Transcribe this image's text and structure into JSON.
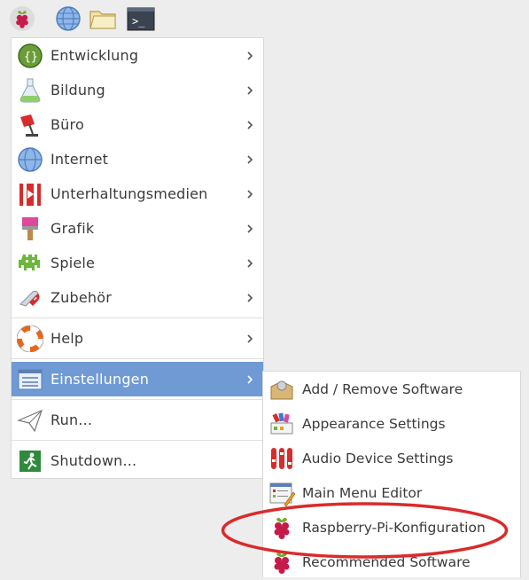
{
  "taskbar": {
    "icons": [
      "raspberry-icon",
      "globe-icon",
      "folder-icon",
      "terminal-icon"
    ],
    "terminal_glyph": ">_"
  },
  "menu": {
    "items": [
      {
        "label": "Entwicklung",
        "icon": "development-icon",
        "submenu": true
      },
      {
        "label": "Bildung",
        "icon": "education-flask-icon",
        "submenu": true
      },
      {
        "label": "Büro",
        "icon": "office-lamp-icon",
        "submenu": true
      },
      {
        "label": "Internet",
        "icon": "globe-icon",
        "submenu": true
      },
      {
        "label": "Unterhaltungsmedien",
        "icon": "media-icon",
        "submenu": true
      },
      {
        "label": "Grafik",
        "icon": "paintbrush-icon",
        "submenu": true
      },
      {
        "label": "Spiele",
        "icon": "game-invader-icon",
        "submenu": true
      },
      {
        "label": "Zubehör",
        "icon": "accessories-knife-icon",
        "submenu": true
      }
    ],
    "help": {
      "label": "Help",
      "icon": "lifebuoy-icon",
      "submenu": true
    },
    "settings": {
      "label": "Einstellungen",
      "icon": "settings-icon",
      "submenu": true,
      "selected": true
    },
    "run": {
      "label": "Run...",
      "icon": "paper-plane-icon"
    },
    "shutdown": {
      "label": "Shutdown...",
      "icon": "exit-running-man-icon"
    }
  },
  "submenu": {
    "items": [
      {
        "label": "Add / Remove Software",
        "icon": "package-box-icon"
      },
      {
        "label": "Appearance Settings",
        "icon": "palette-icon"
      },
      {
        "label": "Audio Device Settings",
        "icon": "audio-sliders-icon"
      },
      {
        "label": "Main Menu Editor",
        "icon": "menu-editor-icon"
      },
      {
        "label": "Raspberry-Pi-Konfiguration",
        "icon": "raspberry-icon",
        "highlighted": true
      },
      {
        "label": "Recommended Software",
        "icon": "raspberry-icon"
      }
    ]
  },
  "colors": {
    "selection": "#6f9ad4",
    "annotation": "#d92b2b",
    "raspberry": "#c51a4a",
    "leaf": "#75a928"
  }
}
